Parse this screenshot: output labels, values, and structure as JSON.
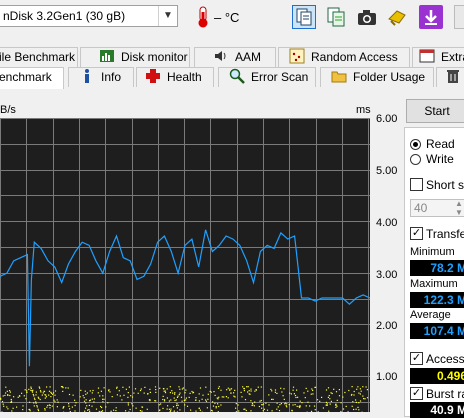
{
  "toolbar": {
    "drive": "nDisk 3.2Gen1 (30 gB)",
    "temperature": "– °C",
    "icons": [
      "thermometer-icon",
      "copy-text-icon",
      "copy-info-icon",
      "screenshot-camera-icon",
      "save-icon",
      "download-icon"
    ]
  },
  "tabs_top": [
    "ile Benchmark",
    "Disk monitor",
    "AAM",
    "Random Access",
    "Extra"
  ],
  "tabs_bottom": [
    "enchmark",
    "Info",
    "Health",
    "Error Scan",
    "Folder Usage"
  ],
  "chart": {
    "left_unit": "B/s",
    "right_unit": "ms",
    "ms_ticks": [
      "6.00",
      "5.00",
      "4.00",
      "3.00",
      "2.00",
      "1.00"
    ]
  },
  "panel": {
    "start": "Start",
    "read": "Read",
    "write": "Write",
    "short_stroke": "Short str",
    "stroke_value": "40",
    "transfer_rate": "Transfer",
    "minimum_label": "Minimum",
    "minimum_value": "78.2 M",
    "maximum_label": "Maximum",
    "maximum_value": "122.3 M",
    "average_label": "Average",
    "average_value": "107.4 M",
    "access_time": "Access t",
    "access_value": "0.496",
    "burst_rate": "Burst rat",
    "burst_value": "40.9 M"
  },
  "chart_data": {
    "type": "line",
    "y_right_label": "ms",
    "y_right_range": [
      0,
      6
    ],
    "y_right_ticks": [
      6,
      5,
      4,
      3,
      2,
      1
    ],
    "series": [
      {
        "color": "#1ea0ff",
        "values": [
          107,
          108,
          112,
          113,
          114,
          118,
          116,
          112,
          110,
          105,
          111,
          115,
          118,
          117,
          112,
          108,
          115,
          120,
          113,
          112,
          106,
          107,
          111,
          118,
          120,
          115,
          108,
          117,
          119,
          110,
          122,
          115,
          117,
          120,
          119,
          117,
          112,
          105,
          115,
          117,
          116,
          121,
          119,
          120,
          100,
          100,
          99,
          100,
          100,
          100,
          100,
          98,
          100,
          101,
          100
        ]
      }
    ]
  }
}
